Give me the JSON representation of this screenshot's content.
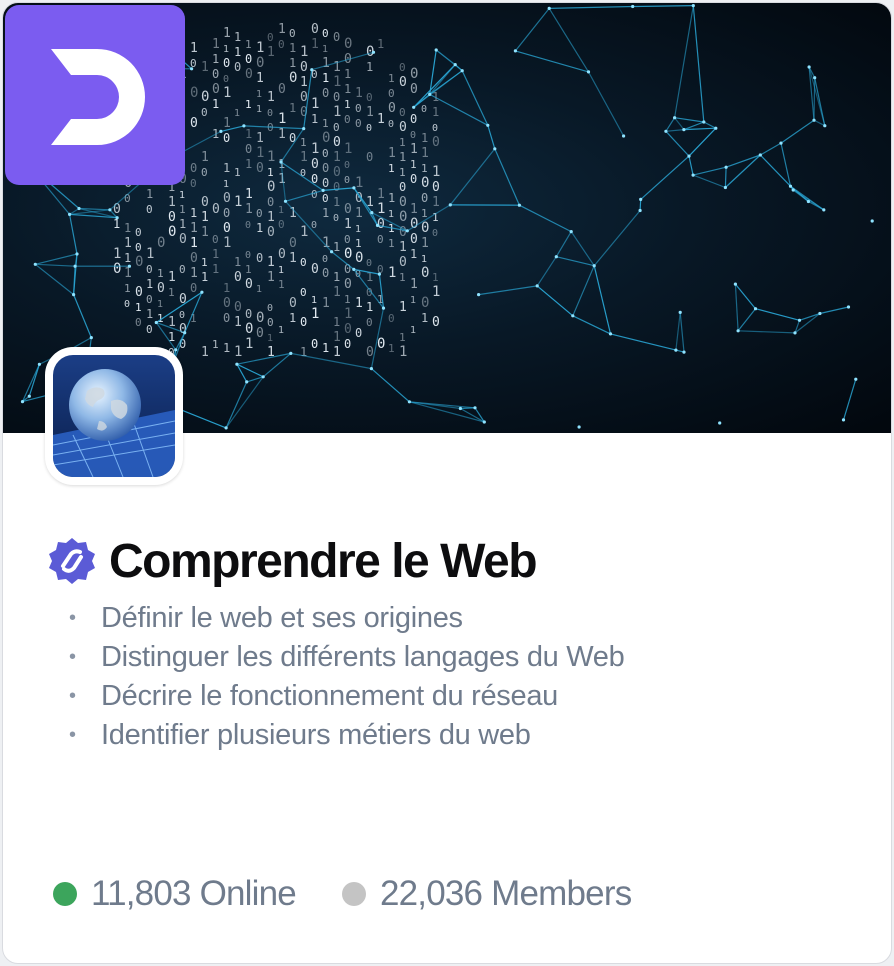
{
  "group": {
    "title": "Comprendre le Web",
    "objectives": [
      "Définir le web et ses origines",
      "Distinguer les différents langages du Web",
      "Décrire le fonctionnement du réseau",
      "Identifier plusieurs métiers du web"
    ],
    "bullet": "•"
  },
  "stats": {
    "online_label": "11,803 Online",
    "members_label": "22,036 Members"
  },
  "icons": {
    "brand": "brand-logo-icon",
    "verified": "verified-badge-icon",
    "online_dot": "online-status-dot",
    "members_dot": "members-status-dot"
  },
  "colors": {
    "brand": "#7b5cf0",
    "verified": "#5b5bd6",
    "online": "#3ca55c",
    "members": "#c4c4c4",
    "title": "#0d0d0f",
    "muted_text": "#6f7b8c",
    "network_lines": "#2aa9d8"
  }
}
